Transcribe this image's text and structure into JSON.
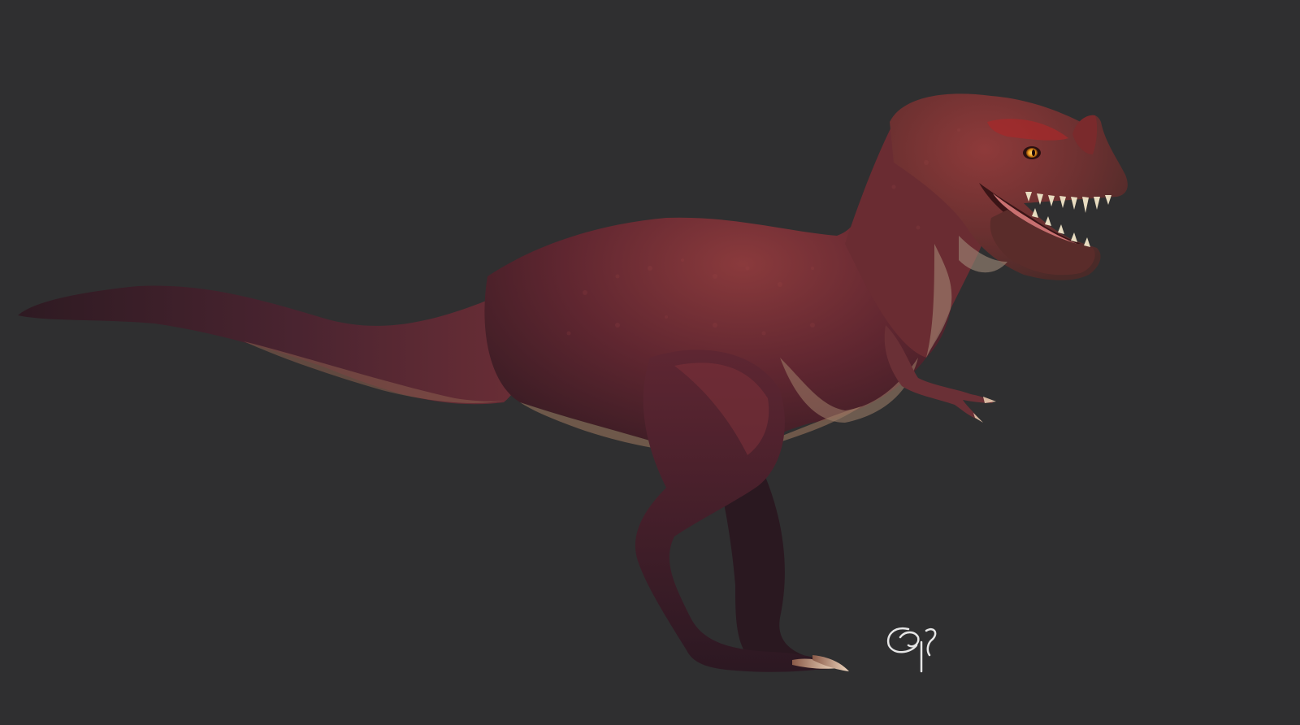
{
  "scene": {
    "subject": "dinosaur-render",
    "background_color": "#2f2f30",
    "colors": {
      "skin_dark": "#3a1c24",
      "skin_mid": "#6b2a33",
      "skin_light": "#8a3a3c",
      "belly": "#8c6a55",
      "eye": "#f0a020",
      "teeth": "#e8dcc0",
      "mouth": "#c87070",
      "claw": "#d8b8a0",
      "signature": "#e6e6e6"
    },
    "icons": {
      "signature": "artist-signature-mark"
    }
  }
}
